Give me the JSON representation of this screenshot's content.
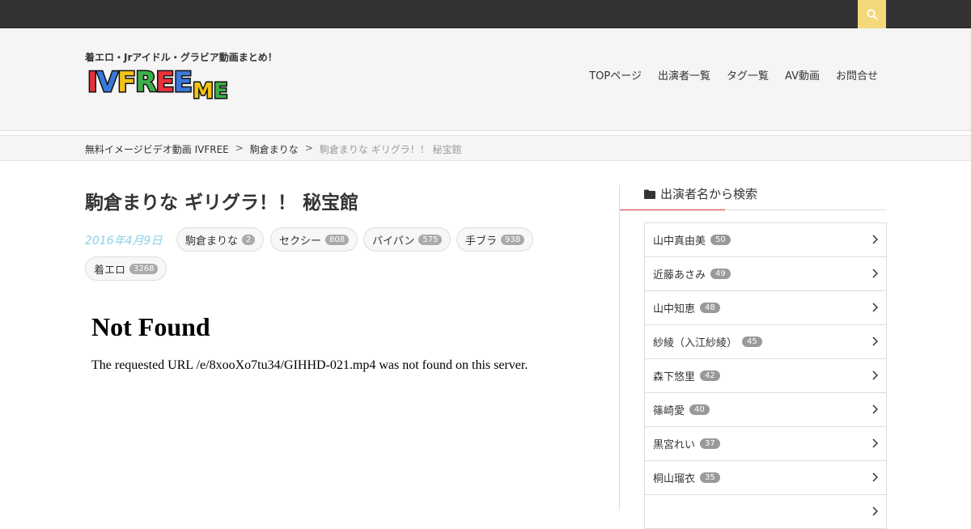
{
  "header": {
    "tagline": "着エロ・Jrアイドル・グラビア動画まとめ！",
    "logo_text": "IVFREE.ME",
    "nav": [
      "TOPページ",
      "出演者一覧",
      "タグ一覧",
      "AV動画",
      "お問合せ"
    ],
    "search_icon": "search-icon",
    "colors": {
      "topbar": "#333333",
      "search": "#f3d97a"
    }
  },
  "breadcrumb": {
    "items": [
      "無料イメージビデオ動画 IVFREE",
      "駒倉まりな"
    ],
    "separator": ">",
    "current": "駒倉まりな ギリグラ！！ 秘宝館"
  },
  "post": {
    "title": "駒倉まりな ギリグラ！！ 秘宝館",
    "date": "2016年4月9日",
    "tags": [
      {
        "label": "駒倉まりな",
        "count": "2"
      },
      {
        "label": "セクシー",
        "count": "808"
      },
      {
        "label": "パイパン",
        "count": "575"
      },
      {
        "label": "手ブラ",
        "count": "938"
      },
      {
        "label": "着エロ",
        "count": "3268"
      }
    ],
    "embed": {
      "title": "Not Found",
      "message": "The requested URL /e/8xooXo7tu34/GIHHD-021.mp4 was not found on this server."
    }
  },
  "sidebar": {
    "widget_title": "出演者名から検索",
    "widget_icon": "folder-icon",
    "items": [
      {
        "name": "山中真由美",
        "count": "50"
      },
      {
        "name": "近藤あさみ",
        "count": "49"
      },
      {
        "name": "山中知恵",
        "count": "48"
      },
      {
        "name": "紗綾（入江紗綾）",
        "count": "45"
      },
      {
        "name": "森下悠里",
        "count": "42"
      },
      {
        "name": "篠崎愛",
        "count": "40"
      },
      {
        "name": "黒宮れい",
        "count": "37"
      },
      {
        "name": "桐山瑠衣",
        "count": "35"
      },
      {
        "name": "",
        "count": ""
      }
    ]
  }
}
